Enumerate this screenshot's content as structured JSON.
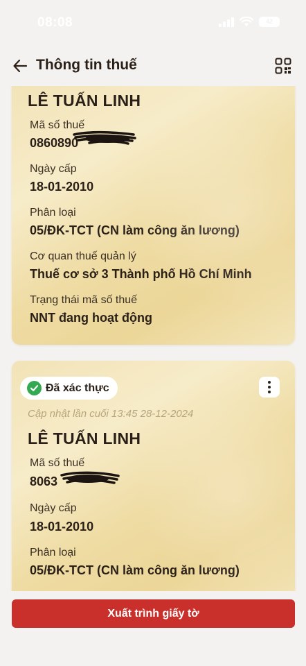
{
  "status_bar": {
    "time": "08:08",
    "battery": "42",
    "icons": [
      "signal-icon",
      "wifi-icon",
      "battery-icon"
    ]
  },
  "header": {
    "title": "Thông tin thuế",
    "back_icon": "arrow-left-icon",
    "qr_icon": "qr-code-icon"
  },
  "colors": {
    "accent_red": "#c9302c",
    "verified_green": "#35a852",
    "card_gold": "#f2e3b7"
  },
  "cards": [
    {
      "owner_name": "LÊ TUẤN LINH",
      "fields": [
        {
          "label": "Mã số thuế",
          "value": "0860890"
        },
        {
          "label": "Ngày cấp",
          "value": "18-01-2010"
        },
        {
          "label": "Phân loại",
          "value": "05/ĐK-TCT (CN làm công ăn lương)"
        },
        {
          "label": "Cơ quan thuế quản lý",
          "value": "Thuế cơ sở 3 Thành phố Hồ Chí Minh"
        },
        {
          "label": "Trạng thái mã số thuế",
          "value": "NNT đang hoạt động"
        }
      ]
    },
    {
      "badge": "Đã xác thực",
      "updated": "Cập nhật lần cuối 13:45 28-12-2024",
      "owner_name": "LÊ TUẤN LINH",
      "fields": [
        {
          "label": "Mã số thuế",
          "value": "8063"
        },
        {
          "label": "Ngày cấp",
          "value": "18-01-2010"
        },
        {
          "label": "Phân loại",
          "value": "05/ĐK-TCT (CN làm công ăn lương)"
        }
      ]
    }
  ],
  "footer": {
    "export_label": "Xuất trình giấy tờ"
  }
}
